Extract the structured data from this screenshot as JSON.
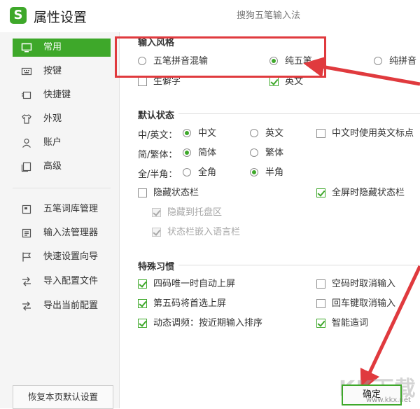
{
  "window": {
    "title": "属性设置",
    "subtitle": "搜狗五笔输入法",
    "logo_text": "S"
  },
  "sidebar": {
    "items": [
      {
        "label": "常用",
        "icon": "monitor-icon",
        "active": true
      },
      {
        "label": "按键",
        "icon": "keyboard-icon"
      },
      {
        "label": "快捷键",
        "icon": "shortcut-icon"
      },
      {
        "label": "外观",
        "icon": "shirt-icon"
      },
      {
        "label": "账户",
        "icon": "user-icon"
      },
      {
        "label": "高级",
        "icon": "advanced-icon"
      },
      {
        "label": "五笔词库管理",
        "icon": "dictionary-icon"
      },
      {
        "label": "输入法管理器",
        "icon": "manager-icon"
      },
      {
        "label": "快速设置向导",
        "icon": "flag-icon"
      },
      {
        "label": "导入配置文件",
        "icon": "import-icon"
      },
      {
        "label": "导出当前配置",
        "icon": "export-icon"
      }
    ],
    "reset_button": "恢复本页默认设置"
  },
  "input_style": {
    "title": "输入风格",
    "options": {
      "wubi_pinyin_mixed": "五笔拼音混输",
      "pure_wubi": "纯五笔",
      "pure_pinyin": "纯拼音"
    },
    "selected": "纯五笔",
    "rare_chars": "生僻字",
    "english": "英文"
  },
  "default_state": {
    "title": "默认状态",
    "cn_en_label": "中/英文：",
    "cn": "中文",
    "en": "英文",
    "cn_en_punct": "中文时使用英文标点",
    "simp_trad_label": "简/繁体：",
    "simplified": "简体",
    "traditional": "繁体",
    "width_label": "全/半角：",
    "full_width": "全角",
    "half_width": "半角",
    "hide_status_bar": "隐藏状态栏",
    "hide_in_fullscreen": "全屏时隐藏状态栏",
    "hide_to_tray": "隐藏到托盘区",
    "embed_language_bar": "状态栏嵌入语言栏"
  },
  "special_habits": {
    "title": "特殊习惯",
    "auto_commit_4": "四码唯一时自动上屏",
    "cancel_on_empty": "空码时取消输入",
    "fifth_code_first": "第五码将首选上屏",
    "enter_cancels": "回车键取消输入",
    "dynamic_order": "动态调频：按近期输入排序",
    "smart_words": "智能造词"
  },
  "ok_button": "确定",
  "watermark": {
    "text": "KK下载",
    "url": "www.kkx.net"
  },
  "colors": {
    "accent": "#3ea82a",
    "annotation": "#e03a3e"
  }
}
